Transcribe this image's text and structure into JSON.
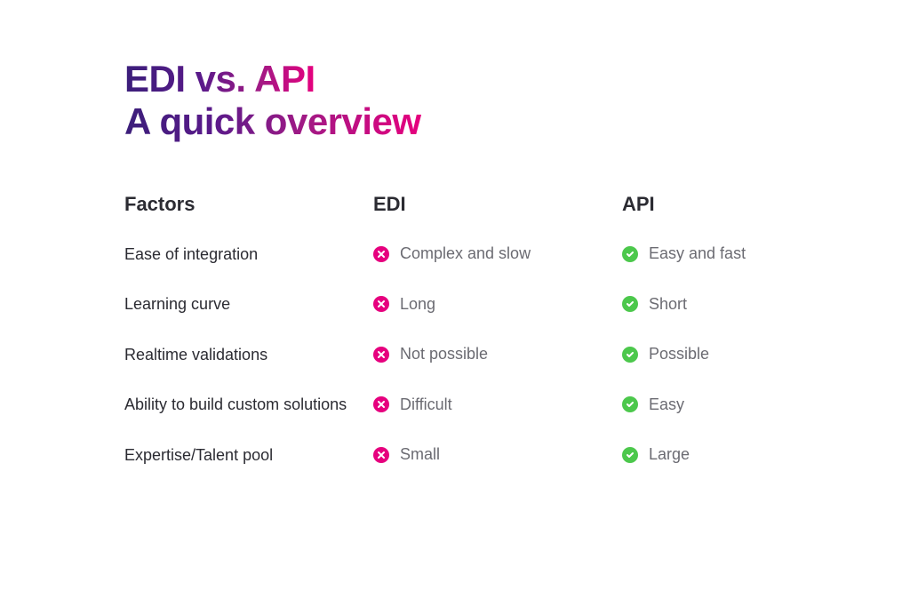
{
  "title": {
    "line1": "EDI vs. API",
    "line2": "A quick overview"
  },
  "headers": {
    "factors": "Factors",
    "edi": "EDI",
    "api": "API"
  },
  "rows": [
    {
      "factor": "Ease of integration",
      "edi": {
        "text": "Complex and slow",
        "status": "negative"
      },
      "api": {
        "text": "Easy and fast",
        "status": "positive"
      }
    },
    {
      "factor": "Learning curve",
      "edi": {
        "text": "Long",
        "status": "negative"
      },
      "api": {
        "text": "Short",
        "status": "positive"
      }
    },
    {
      "factor": "Realtime validations",
      "edi": {
        "text": "Not possible",
        "status": "negative"
      },
      "api": {
        "text": "Possible",
        "status": "positive"
      }
    },
    {
      "factor": "Ability to build custom solutions",
      "edi": {
        "text": "Difficult",
        "status": "negative"
      },
      "api": {
        "text": "Easy",
        "status": "positive"
      }
    },
    {
      "factor": "Expertise/Talent pool",
      "edi": {
        "text": "Small",
        "status": "negative"
      },
      "api": {
        "text": "Large",
        "status": "positive"
      }
    }
  ]
}
